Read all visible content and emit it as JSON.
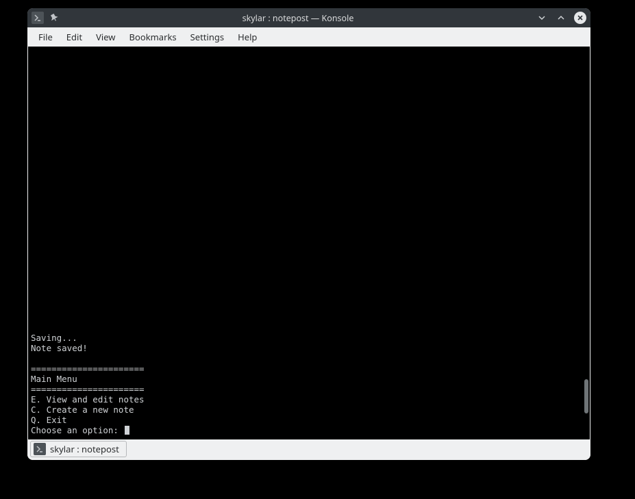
{
  "titlebar": {
    "title": "skylar : notepost — Konsole"
  },
  "menubar": {
    "items": [
      "File",
      "Edit",
      "View",
      "Bookmarks",
      "Settings",
      "Help"
    ]
  },
  "terminal": {
    "lines": [
      "Saving...",
      "Note saved!",
      "",
      "======================",
      "Main Menu",
      "======================",
      "E. View and edit notes",
      "C. Create a new note",
      "Q. Exit"
    ],
    "prompt": "Choose an option: "
  },
  "tabbar": {
    "tab_label": "skylar : notepost"
  }
}
